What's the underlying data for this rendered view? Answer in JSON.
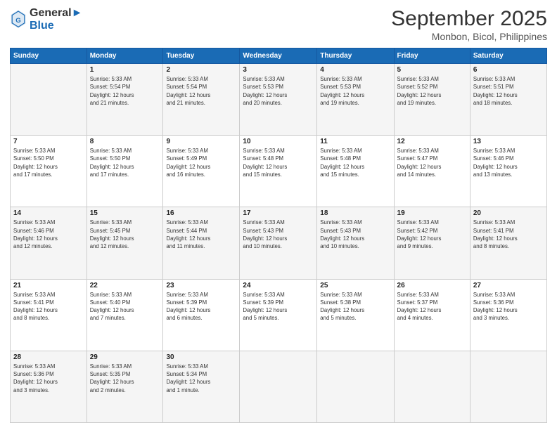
{
  "logo": {
    "line1": "General",
    "line2": "Blue"
  },
  "title": "September 2025",
  "subtitle": "Monbon, Bicol, Philippines",
  "days_of_week": [
    "Sunday",
    "Monday",
    "Tuesday",
    "Wednesday",
    "Thursday",
    "Friday",
    "Saturday"
  ],
  "weeks": [
    [
      {
        "num": "",
        "info": ""
      },
      {
        "num": "1",
        "info": "Sunrise: 5:33 AM\nSunset: 5:54 PM\nDaylight: 12 hours\nand 21 minutes."
      },
      {
        "num": "2",
        "info": "Sunrise: 5:33 AM\nSunset: 5:54 PM\nDaylight: 12 hours\nand 21 minutes."
      },
      {
        "num": "3",
        "info": "Sunrise: 5:33 AM\nSunset: 5:53 PM\nDaylight: 12 hours\nand 20 minutes."
      },
      {
        "num": "4",
        "info": "Sunrise: 5:33 AM\nSunset: 5:53 PM\nDaylight: 12 hours\nand 19 minutes."
      },
      {
        "num": "5",
        "info": "Sunrise: 5:33 AM\nSunset: 5:52 PM\nDaylight: 12 hours\nand 19 minutes."
      },
      {
        "num": "6",
        "info": "Sunrise: 5:33 AM\nSunset: 5:51 PM\nDaylight: 12 hours\nand 18 minutes."
      }
    ],
    [
      {
        "num": "7",
        "info": "Sunrise: 5:33 AM\nSunset: 5:50 PM\nDaylight: 12 hours\nand 17 minutes."
      },
      {
        "num": "8",
        "info": "Sunrise: 5:33 AM\nSunset: 5:50 PM\nDaylight: 12 hours\nand 17 minutes."
      },
      {
        "num": "9",
        "info": "Sunrise: 5:33 AM\nSunset: 5:49 PM\nDaylight: 12 hours\nand 16 minutes."
      },
      {
        "num": "10",
        "info": "Sunrise: 5:33 AM\nSunset: 5:48 PM\nDaylight: 12 hours\nand 15 minutes."
      },
      {
        "num": "11",
        "info": "Sunrise: 5:33 AM\nSunset: 5:48 PM\nDaylight: 12 hours\nand 15 minutes."
      },
      {
        "num": "12",
        "info": "Sunrise: 5:33 AM\nSunset: 5:47 PM\nDaylight: 12 hours\nand 14 minutes."
      },
      {
        "num": "13",
        "info": "Sunrise: 5:33 AM\nSunset: 5:46 PM\nDaylight: 12 hours\nand 13 minutes."
      }
    ],
    [
      {
        "num": "14",
        "info": "Sunrise: 5:33 AM\nSunset: 5:46 PM\nDaylight: 12 hours\nand 12 minutes."
      },
      {
        "num": "15",
        "info": "Sunrise: 5:33 AM\nSunset: 5:45 PM\nDaylight: 12 hours\nand 12 minutes."
      },
      {
        "num": "16",
        "info": "Sunrise: 5:33 AM\nSunset: 5:44 PM\nDaylight: 12 hours\nand 11 minutes."
      },
      {
        "num": "17",
        "info": "Sunrise: 5:33 AM\nSunset: 5:43 PM\nDaylight: 12 hours\nand 10 minutes."
      },
      {
        "num": "18",
        "info": "Sunrise: 5:33 AM\nSunset: 5:43 PM\nDaylight: 12 hours\nand 10 minutes."
      },
      {
        "num": "19",
        "info": "Sunrise: 5:33 AM\nSunset: 5:42 PM\nDaylight: 12 hours\nand 9 minutes."
      },
      {
        "num": "20",
        "info": "Sunrise: 5:33 AM\nSunset: 5:41 PM\nDaylight: 12 hours\nand 8 minutes."
      }
    ],
    [
      {
        "num": "21",
        "info": "Sunrise: 5:33 AM\nSunset: 5:41 PM\nDaylight: 12 hours\nand 8 minutes."
      },
      {
        "num": "22",
        "info": "Sunrise: 5:33 AM\nSunset: 5:40 PM\nDaylight: 12 hours\nand 7 minutes."
      },
      {
        "num": "23",
        "info": "Sunrise: 5:33 AM\nSunset: 5:39 PM\nDaylight: 12 hours\nand 6 minutes."
      },
      {
        "num": "24",
        "info": "Sunrise: 5:33 AM\nSunset: 5:39 PM\nDaylight: 12 hours\nand 5 minutes."
      },
      {
        "num": "25",
        "info": "Sunrise: 5:33 AM\nSunset: 5:38 PM\nDaylight: 12 hours\nand 5 minutes."
      },
      {
        "num": "26",
        "info": "Sunrise: 5:33 AM\nSunset: 5:37 PM\nDaylight: 12 hours\nand 4 minutes."
      },
      {
        "num": "27",
        "info": "Sunrise: 5:33 AM\nSunset: 5:36 PM\nDaylight: 12 hours\nand 3 minutes."
      }
    ],
    [
      {
        "num": "28",
        "info": "Sunrise: 5:33 AM\nSunset: 5:36 PM\nDaylight: 12 hours\nand 3 minutes."
      },
      {
        "num": "29",
        "info": "Sunrise: 5:33 AM\nSunset: 5:35 PM\nDaylight: 12 hours\nand 2 minutes."
      },
      {
        "num": "30",
        "info": "Sunrise: 5:33 AM\nSunset: 5:34 PM\nDaylight: 12 hours\nand 1 minute."
      },
      {
        "num": "",
        "info": ""
      },
      {
        "num": "",
        "info": ""
      },
      {
        "num": "",
        "info": ""
      },
      {
        "num": "",
        "info": ""
      }
    ]
  ]
}
